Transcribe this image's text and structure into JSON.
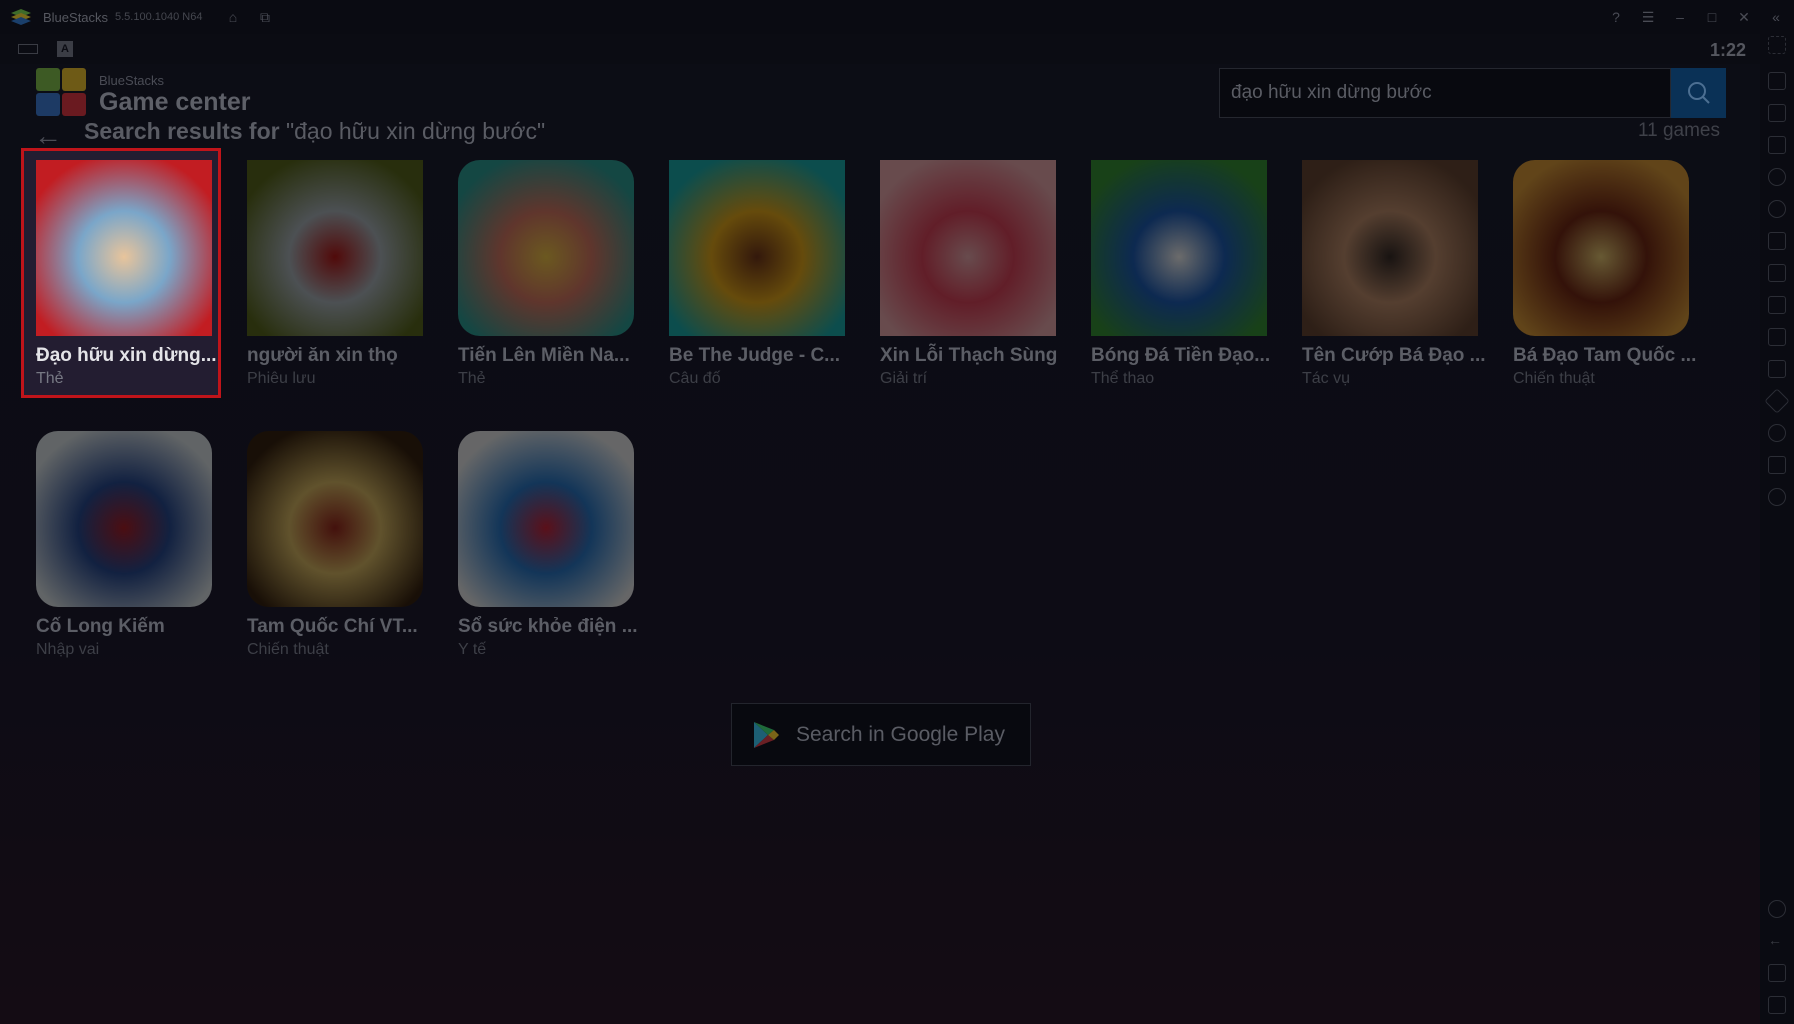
{
  "window": {
    "app_name": "BlueStacks",
    "version": "5.5.100.1040 N64",
    "clock": "1:22",
    "title_icons": [
      "home-icon",
      "multi-instance-icon",
      "help-icon",
      "menu-icon",
      "minimize-icon",
      "maximize-icon",
      "close-icon",
      "collapse-sidebar-icon"
    ]
  },
  "header": {
    "brand_small": "BlueStacks",
    "brand_title": "Game center",
    "results_prefix": "Search results for ",
    "query_quoted": "\"đạo hữu xin dừng bước\"",
    "search_value": "đạo hữu xin dừng bước",
    "result_count": "11 games"
  },
  "games": [
    {
      "title": "Đạo hữu xin dừng...",
      "category": "Thẻ",
      "selected": true,
      "colors": [
        "#c21d22",
        "#7aa6c9",
        "#e8c49b"
      ]
    },
    {
      "title": "người ăn xin thọ",
      "category": "Phiêu lưu",
      "colors": [
        "#5f6e1e",
        "#b5bfc6",
        "#c01818"
      ]
    },
    {
      "title": "Tiến Lên Miền Na...",
      "category": "Thẻ",
      "colors": [
        "#30a8a0",
        "#e37f6a",
        "#ffd24c"
      ]
    },
    {
      "title": "Be The Judge - C...",
      "category": "Câu đố",
      "colors": [
        "#1cb8b8",
        "#f2b21c",
        "#7a3a1c"
      ]
    },
    {
      "title": "Xin Lỗi Thạch Sùng",
      "category": "Giải trí",
      "colors": [
        "#f7b3b8",
        "#e84760",
        "#f7b3b8"
      ]
    },
    {
      "title": "Bóng Đá Tiền Đạo...",
      "category": "Thể thao",
      "colors": [
        "#3a9a3a",
        "#1f62c0",
        "#ffffff"
      ]
    },
    {
      "title": "Tên Cướp Bá Đạo ...",
      "category": "Tác vụ",
      "colors": [
        "#6d4a36",
        "#c99572",
        "#3a2e2a"
      ]
    },
    {
      "title": "Bá Đạo Tam Quốc ...",
      "category": "Chiến thuật",
      "colors": [
        "#e6a23c",
        "#7a2b16",
        "#f5d47a"
      ]
    },
    {
      "title": "Cố Long Kiếm",
      "category": "Nhập vai",
      "colors": [
        "#e6eef2",
        "#2b4f9a",
        "#b3202a"
      ]
    },
    {
      "title": "Tam Quốc Chí VT...",
      "category": "Chiến thuật",
      "colors": [
        "#3a2410",
        "#e6c46a",
        "#a0281e"
      ]
    },
    {
      "title": "Sổ sức khỏe điện ...",
      "category": "Y tế",
      "colors": [
        "#f2f4f6",
        "#2d7fd2",
        "#d7263d"
      ]
    }
  ],
  "google_play_button": "Search in Google Play"
}
